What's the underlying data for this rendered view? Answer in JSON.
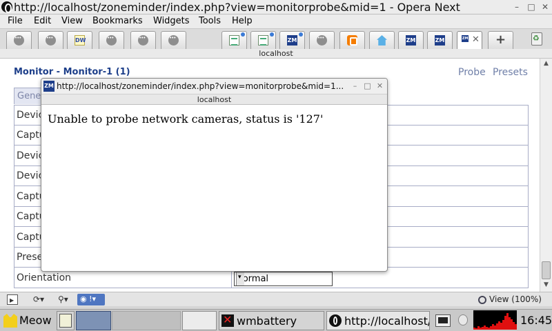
{
  "window": {
    "title": "http://localhost/zoneminder/index.php?view=monitorprobe&mid=1 - Opera Next",
    "minimize": "–",
    "maximize": "□",
    "close": "✕"
  },
  "menu": [
    "File",
    "Edit",
    "View",
    "Bookmarks",
    "Widgets",
    "Tools",
    "Help"
  ],
  "tabs": [
    {
      "icon": "dots"
    },
    {
      "icon": "dots"
    },
    {
      "icon": "dw",
      "text": "DW"
    },
    {
      "icon": "dots"
    },
    {
      "icon": "dots"
    },
    {
      "icon": "dots"
    },
    {
      "icon": "doc"
    },
    {
      "icon": "doc"
    },
    {
      "icon": "zm",
      "text": "ZM"
    },
    {
      "icon": "dots"
    },
    {
      "icon": "blogger"
    },
    {
      "icon": "home"
    },
    {
      "icon": "zm",
      "text": "ZM"
    },
    {
      "icon": "zm",
      "text": "ZM"
    },
    {
      "icon": "zm-active",
      "text": "ZM"
    }
  ],
  "addr_strip": "localhost",
  "page": {
    "title": "Monitor - Monitor-1 (1)",
    "probe_link": "Probe",
    "presets_link": "Presets",
    "tab_label": "Gene",
    "rows": [
      "Devic",
      "Captu",
      "Devic",
      "Devic",
      "Captu",
      "Captu",
      "Captu",
      "Prese",
      "Orientation"
    ],
    "orientation_value": "Normal"
  },
  "statusbar": {
    "zoom": "View (100%)",
    "unite_label": "!"
  },
  "popup": {
    "title": "http://localhost/zoneminder/index.php?view=monitorprobe&mid=1...",
    "icon_text": "ZM",
    "host": "localhost",
    "message": "Unable to probe network cameras, status is '127'",
    "minimize": "–",
    "maximize": "□",
    "close": "✕"
  },
  "taskbar": {
    "meow": "Meow",
    "wmbattery": "wmbattery",
    "opera": "http://localhost/",
    "clock": "16:45"
  },
  "tray_graph": [
    2,
    3,
    2,
    5,
    3,
    4,
    6,
    4,
    3,
    5,
    8,
    6,
    9,
    12,
    10,
    14,
    20,
    24,
    18,
    15,
    11,
    8
  ]
}
